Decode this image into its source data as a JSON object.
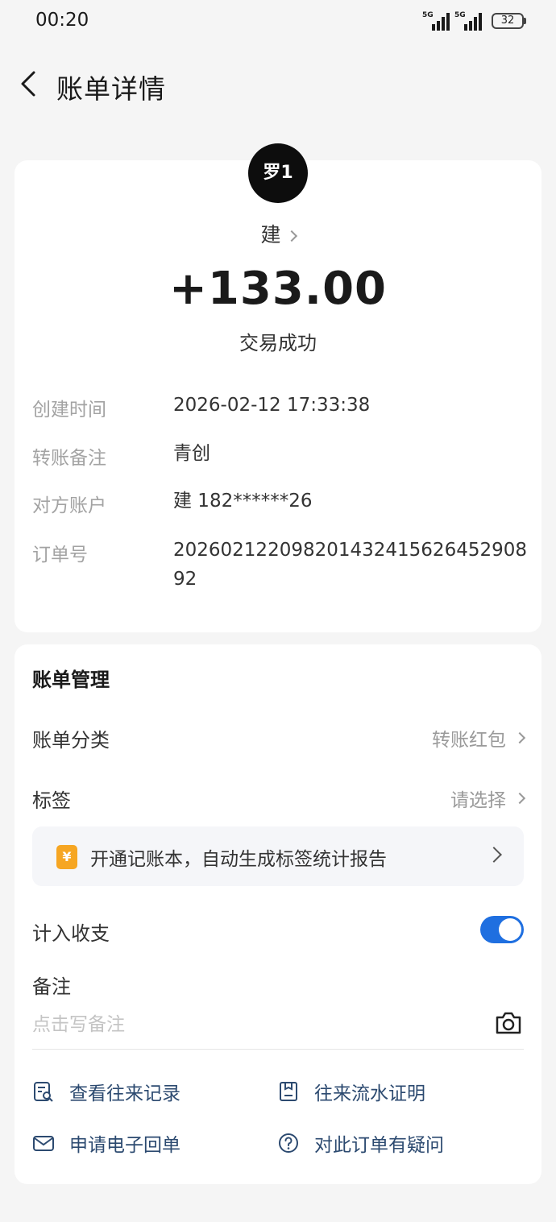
{
  "status_bar": {
    "time": "00:20",
    "network1": "5G",
    "network2": "5G",
    "battery": "32"
  },
  "header": {
    "title": "账单详情"
  },
  "detail": {
    "avatar_text": "罗1",
    "counterparty": "建",
    "amount": "+133.00",
    "status": "交易成功",
    "rows": [
      {
        "label": "创建时间",
        "value": "2026-02-12  17:33:38"
      },
      {
        "label": "转账备注",
        "value": "青创"
      },
      {
        "label": "对方账户",
        "value": "建 182******26"
      },
      {
        "label": "订单号",
        "value": "20260212209820143241562645290892"
      }
    ]
  },
  "manage": {
    "title": "账单管理",
    "category_label": "账单分类",
    "category_value": "转账红包",
    "tag_label": "标签",
    "tag_value": "请选择",
    "promo_icon": "¥",
    "promo_text": "开通记账本，自动生成标签统计报告",
    "include_label": "计入收支",
    "include_enabled": true,
    "remark_label": "备注",
    "remark_placeholder": "点击写备注",
    "actions": [
      {
        "label": "查看往来记录",
        "icon": "record-search-icon"
      },
      {
        "label": "往来流水证明",
        "icon": "statement-proof-icon"
      },
      {
        "label": "申请电子回单",
        "icon": "mail-icon"
      },
      {
        "label": "对此订单有疑问",
        "icon": "question-icon"
      }
    ]
  },
  "colors": {
    "accent": "#1f6fe0",
    "action_text": "#2c4a70",
    "promo_icon": "#f6a623"
  }
}
